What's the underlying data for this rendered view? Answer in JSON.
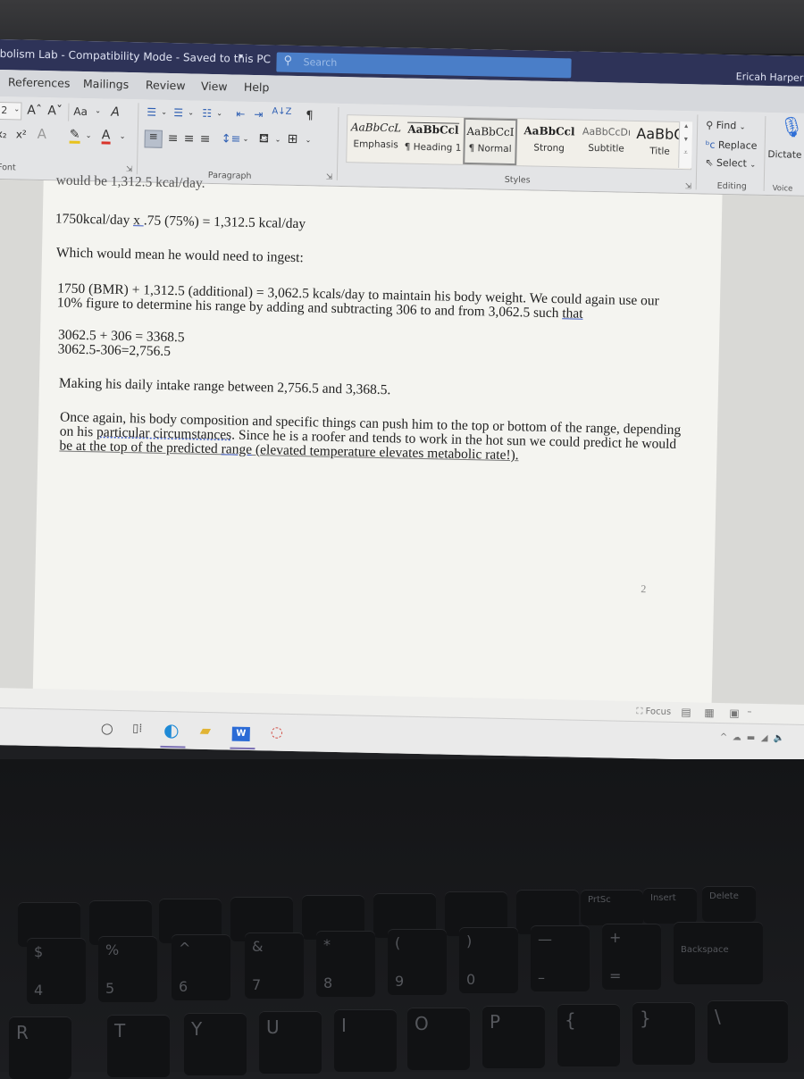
{
  "window": {
    "title": "bolism Lab  -  Compatibility Mode  -  Saved to this PC",
    "title_dropdown_icon": "chevron-down-icon",
    "search_placeholder": "Search",
    "user_name": "Ericah Harper"
  },
  "tabs": [
    "References",
    "Mailings",
    "Review",
    "View",
    "Help"
  ],
  "ribbon": {
    "font": {
      "size_value": "2",
      "grow_icon": "Aˆ",
      "shrink_icon": "Aˇ",
      "change_case_label": "Aa",
      "clear_format_icon": "A",
      "subscript_icon": "x₂",
      "superscript_icon": "x²",
      "text_effects_icon": "A",
      "highlight_icon": "✎",
      "font_color_icon": "A",
      "group_label": "Font",
      "highlight_color": "#e8c21c",
      "font_color": "#d9342b"
    },
    "paragraph": {
      "group_label": "Paragraph",
      "pilcrow": "¶",
      "sort_icon": "A↓Z"
    },
    "styles": {
      "group_label": "Styles",
      "items": [
        {
          "sample": "AaBbCcL",
          "name": "Emphasis"
        },
        {
          "sample": "AaBbCcl",
          "name": "¶ Heading 1"
        },
        {
          "sample": "AaBbCcI",
          "name": "¶ Normal",
          "selected": true
        },
        {
          "sample": "AaBbCcl",
          "name": "Strong"
        },
        {
          "sample": "AaBbCcDı",
          "name": "Subtitle"
        },
        {
          "sample": "AaBbC",
          "name": "Title"
        }
      ]
    },
    "editing": {
      "group_label": "Editing",
      "find": "Find",
      "replace": "Replace",
      "select": "Select"
    },
    "voice": {
      "group_label": "Voice",
      "dictate": "Dictate"
    }
  },
  "document": {
    "cut_line": "would be 1,312.5 kcal/day.",
    "line1_pre": "1750kcal/day ",
    "line1_x": "x ",
    "line1_post": ".75 (75%)  = 1,312.5 kcal/day",
    "line2": "Which would mean he would need to ingest:",
    "line3": "1750 (BMR) + 1,312.5 (additional) = 3,062.5 kcals/day to maintain his body weight.  We could again use our",
    "line4_pre": "10% figure to determine his range by adding and subtracting 306 to and from 3,062.5 such ",
    "line4_u": "that",
    "calc1": "3062.5 + 306 = 3368.5",
    "calc2": "3062.5-306=2,756.5",
    "line5": "Making his daily intake range between 2,756.5 and 3,368.5.",
    "line6": "Once again, his body composition and specific things can push him to the top or bottom of the range, depending",
    "line7_pre": "on his ",
    "line7_u": "particular circumstances",
    "line7_post": ".  Since he is a roofer and tends to work in the hot sun we could predict he would",
    "line8_pre": "be at the top of the predicted ",
    "line8_u": "range",
    "line8_post": "  (elevated temperature elevates metabolic rate!).",
    "page_number": "2"
  },
  "status": {
    "focus_label": "Focus"
  },
  "taskbar": {
    "icons": [
      "search-icon",
      "task-view-icon",
      "edge-icon",
      "file-explorer-icon",
      "word-icon",
      "app-icon"
    ]
  },
  "keyboard": {
    "fn_row": [
      "",
      "",
      "",
      "",
      "",
      "",
      "",
      "",
      "",
      "PrtSc",
      "Insert",
      "Delete"
    ],
    "num_row": [
      {
        "top": "$",
        "bottom": "4"
      },
      {
        "top": "%",
        "bottom": "5"
      },
      {
        "top": "^",
        "bottom": "6"
      },
      {
        "top": "&",
        "bottom": "7"
      },
      {
        "top": "*",
        "bottom": "8"
      },
      {
        "top": "(",
        "bottom": "9"
      },
      {
        "top": ")",
        "bottom": "0"
      },
      {
        "top": "—",
        "bottom": "–"
      },
      {
        "top": "+",
        "bottom": "="
      },
      {
        "top": "Backspace",
        "bottom": ""
      }
    ],
    "letter_row": [
      "R",
      "T",
      "Y",
      "U",
      "I",
      "O",
      "P",
      "{",
      "}",
      "\\"
    ]
  }
}
